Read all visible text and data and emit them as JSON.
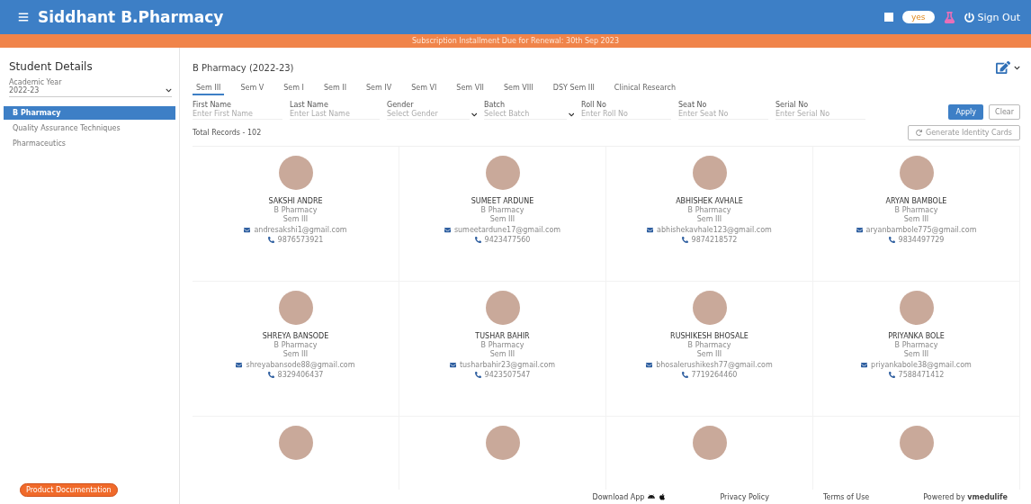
{
  "header": {
    "title": "Siddhant B.Pharmacy",
    "badge": "yes",
    "sign_out": "Sign Out"
  },
  "banner": "Subscription Installment Due for Renewal: 30th Sep 2023",
  "sidebar": {
    "title": "Student Details",
    "year_label": "Academic Year",
    "year_value": "2022-23",
    "items": [
      {
        "label": "B Pharmacy",
        "selected": true
      },
      {
        "label": "Quality Assurance Techniques",
        "selected": false
      },
      {
        "label": "Pharmaceutics",
        "selected": false
      }
    ],
    "doc_button": "Product Documentation"
  },
  "main": {
    "title": "B Pharmacy (2022-23)",
    "tabs": [
      {
        "label": "Sem III",
        "selected": true
      },
      {
        "label": "Sem V",
        "selected": false
      },
      {
        "label": "Sem I",
        "selected": false
      },
      {
        "label": "Sem II",
        "selected": false
      },
      {
        "label": "Sem IV",
        "selected": false
      },
      {
        "label": "Sem VI",
        "selected": false
      },
      {
        "label": "Sem VII",
        "selected": false
      },
      {
        "label": "Sem VIII",
        "selected": false
      },
      {
        "label": "DSY Sem III",
        "selected": false
      },
      {
        "label": "Clinical Research",
        "selected": false
      }
    ],
    "filters": [
      {
        "kind": "text",
        "label": "First Name",
        "placeholder": "Enter First Name"
      },
      {
        "kind": "text",
        "label": "Last Name",
        "placeholder": "Enter Last Name"
      },
      {
        "kind": "select",
        "label": "Gender",
        "placeholder": "Select Gender"
      },
      {
        "kind": "select",
        "label": "Batch",
        "placeholder": "Select Batch"
      },
      {
        "kind": "text",
        "label": "Roll No",
        "placeholder": "Enter Roll No"
      },
      {
        "kind": "text",
        "label": "Seat No",
        "placeholder": "Enter Seat No"
      },
      {
        "kind": "text",
        "label": "Serial No",
        "placeholder": "Enter Serial No"
      }
    ],
    "apply": "Apply",
    "clear": "Clear",
    "generate": "Generate Identity Cards",
    "total": "Total Records - 102",
    "students": [
      {
        "kind": "full",
        "name": "SAKSHI ANDRE",
        "course": "B Pharmacy",
        "sem": "Sem III",
        "email": "andresakshi1@gmail.com",
        "phone": "9876573921"
      },
      {
        "kind": "full",
        "name": "SUMEET ARDUNE",
        "course": "B Pharmacy",
        "sem": "Sem III",
        "email": "sumeetardune17@gmail.com",
        "phone": "9423477560"
      },
      {
        "kind": "full",
        "name": "ABHISHEK AVHALE",
        "course": "B Pharmacy",
        "sem": "Sem III",
        "email": "abhishekavhale123@gmail.com",
        "phone": "9874218572"
      },
      {
        "kind": "full",
        "name": "ARYAN BAMBOLE",
        "course": "B Pharmacy",
        "sem": "Sem III",
        "email": "aryanbambole775@gmail.com",
        "phone": "9834497729"
      },
      {
        "kind": "full",
        "name": "SHREYA BANSODE",
        "course": "B Pharmacy",
        "sem": "Sem III",
        "email": "shreyabansode88@gmail.com",
        "phone": "8329406437"
      },
      {
        "kind": "full",
        "name": "TUSHAR BAHIR",
        "course": "B Pharmacy",
        "sem": "Sem III",
        "email": "tusharbahir23@gmail.com",
        "phone": "9423507547"
      },
      {
        "kind": "full",
        "name": "RUSHIKESH BHOSALE",
        "course": "B Pharmacy",
        "sem": "Sem III",
        "email": "bhosalerushikesh77@gmail.com",
        "phone": "7719264460"
      },
      {
        "kind": "full",
        "name": "PRIYANKA BOLE",
        "course": "B Pharmacy",
        "sem": "Sem III",
        "email": "priyankabole38@gmail.com",
        "phone": "7588471412"
      },
      {
        "kind": "cut"
      },
      {
        "kind": "cut"
      },
      {
        "kind": "cut"
      },
      {
        "kind": "cut"
      }
    ]
  },
  "footer": {
    "download": "Download App",
    "privacy": "Privacy Policy",
    "terms": "Terms of Use",
    "powered": "Powered by **vmedulife**"
  }
}
